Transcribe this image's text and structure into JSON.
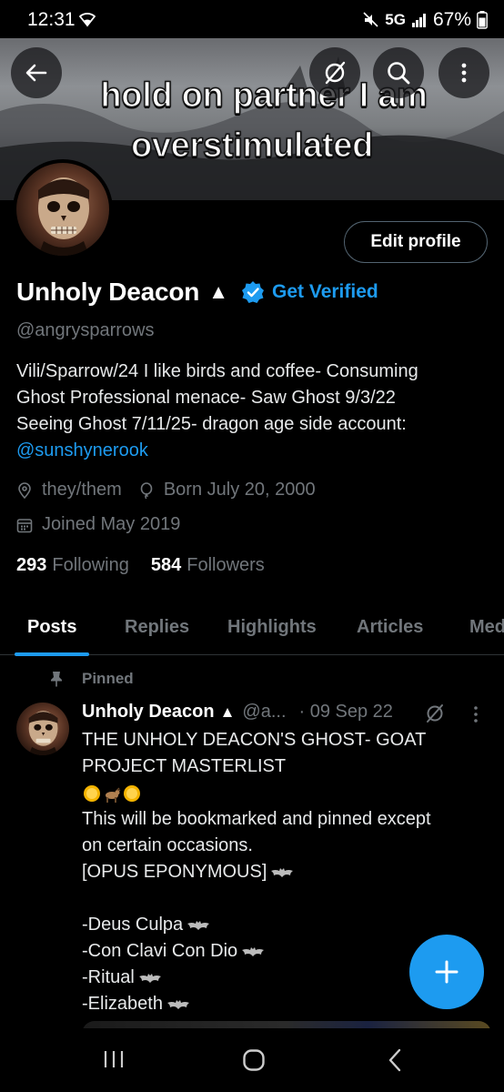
{
  "status_bar": {
    "time": "12:31",
    "network": "5G",
    "battery": "67%"
  },
  "banner": {
    "caption_line1": "hold on partner I am",
    "caption_line2": "overstimulated"
  },
  "header_icons": [
    "back-arrow-icon",
    "grok-icon",
    "search-icon",
    "more-vertical-icon"
  ],
  "profile": {
    "edit_button": "Edit profile",
    "display_name": "Unholy Deacon",
    "name_symbol": "▲",
    "get_verified": "Get Verified",
    "handle": "@angrysparrows",
    "bio_lines": [
      "Vili/Sparrow/24 I like birds and coffee- Consuming",
      "Ghost  Professional menace- Saw Ghost 9/3/22",
      "Seeing Ghost 7/11/25- dragon age side account:"
    ],
    "bio_link": "@sunshynerook",
    "pronouns": "they/them",
    "birthday": "Born July 20, 2000",
    "joined": "Joined May 2019",
    "following_count": "293",
    "following_label": "Following",
    "followers_count": "584",
    "followers_label": "Followers"
  },
  "tabs": [
    "Posts",
    "Replies",
    "Highlights",
    "Articles",
    "Media"
  ],
  "active_tab": "Posts",
  "pinned_post": {
    "pinned_label": "Pinned",
    "author_name": "Unholy Deacon",
    "author_symbol": "▲",
    "author_handle": "@a...",
    "date": "· 09 Sep 22",
    "lines": [
      "THE UNHOLY DEACON'S GHOST- GOAT",
      "PROJECT MASTERLIST",
      "This will be bookmarked and pinned except",
      "on certain occasions.",
      "[OPUS EPONYMOUS]",
      "",
      "-Deus Culpa",
      "-Con Clavi Con Dio",
      "-Ritual",
      "-Elizabeth"
    ]
  },
  "colors": {
    "accent": "#1d9bf0",
    "muted": "#71767b",
    "background": "#000000"
  }
}
